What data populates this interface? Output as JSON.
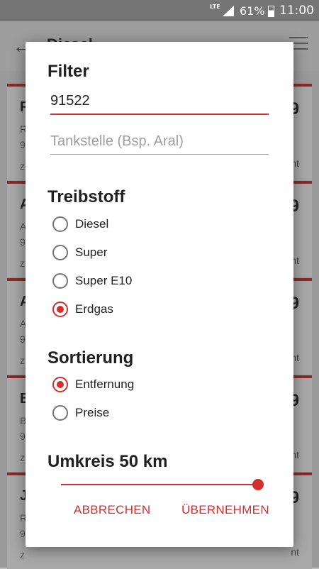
{
  "statusbar": {
    "network": "LTE",
    "battery": "61%",
    "time": "11:00"
  },
  "appbar": {
    "back_icon": "arrow-back-icon",
    "title": "Diesel",
    "filter_icon": "filter-sliders-icon"
  },
  "background_list": [
    {
      "name": "R",
      "line1": "R",
      "line2": "9",
      "line3": "z",
      "price": "9",
      "tag": "nt"
    },
    {
      "name": "A",
      "line1": "A",
      "line2": "9",
      "line3": "z",
      "price": "9",
      "tag": "nt"
    },
    {
      "name": "A",
      "line1": "A",
      "line2": "9",
      "line3": "z",
      "price": "9",
      "tag": "nt"
    },
    {
      "name": "B",
      "line1": "B",
      "line2": "9",
      "line3": "z",
      "price": "9",
      "tag": "nt"
    },
    {
      "name": "J",
      "line1": "R",
      "line2": "9",
      "line3": "z",
      "price": "9",
      "tag": "nt"
    }
  ],
  "dialog": {
    "filter_title": "Filter",
    "zip_value": "91522",
    "station_placeholder": "Tankstelle (Bsp. Aral)",
    "fuel_title": "Treibstoff",
    "fuel_options": [
      {
        "label": "Diesel",
        "checked": false
      },
      {
        "label": "Super",
        "checked": false
      },
      {
        "label": "Super E10",
        "checked": false
      },
      {
        "label": "Erdgas",
        "checked": true
      }
    ],
    "sort_title": "Sortierung",
    "sort_options": [
      {
        "label": "Entfernung",
        "checked": true
      },
      {
        "label": "Preise",
        "checked": false
      }
    ],
    "radius_title": "Umkreis 50 km",
    "radius_value": 50,
    "radius_max": 50,
    "cancel_label": "ABBRECHEN",
    "apply_label": "ÜBERNEHMEN"
  },
  "colors": {
    "accent": "#d32f2f",
    "statusbar": "#757575"
  }
}
